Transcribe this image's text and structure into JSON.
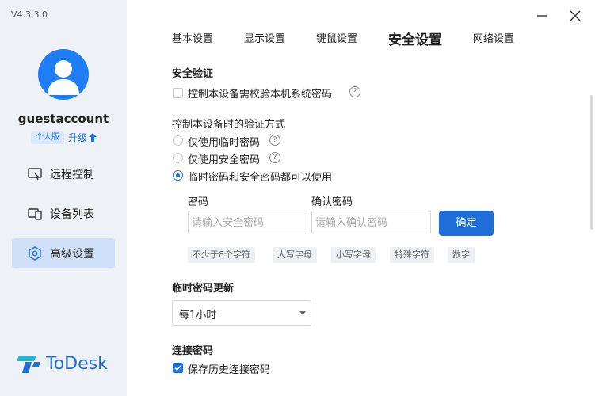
{
  "app": {
    "version": "V4.3.3.0",
    "logo_text": "ToDesk"
  },
  "user": {
    "name": "guestaccount",
    "edition": "个人版",
    "upgrade_label": "升级"
  },
  "sidebar": {
    "items": [
      {
        "label": "远程控制",
        "icon": "remote-control-icon"
      },
      {
        "label": "设备列表",
        "icon": "device-list-icon"
      },
      {
        "label": "高级设置",
        "icon": "hexagon-settings-icon",
        "active": true
      }
    ]
  },
  "tabs": [
    {
      "label": "基本设置"
    },
    {
      "label": "显示设置"
    },
    {
      "label": "键鼠设置"
    },
    {
      "label": "安全设置",
      "active": true
    },
    {
      "label": "网络设置"
    }
  ],
  "security": {
    "verify_title": "安全验证",
    "verify_option": {
      "label": "控制本设备需校验本机系统密码",
      "checked": false
    },
    "method_title": "控制本设备时的验证方式",
    "methods": [
      {
        "label": "仅使用临时密码",
        "selected": false,
        "help": true
      },
      {
        "label": "仅使用安全密码",
        "selected": false,
        "help": true
      },
      {
        "label": "临时密码和安全密码都可以使用",
        "selected": true,
        "help": false
      }
    ],
    "password_label": "密码",
    "password_placeholder": "请输入安全密码",
    "confirm_label": "确认密码",
    "confirm_placeholder": "请输入确认密码",
    "confirm_button": "确定",
    "rules": [
      "不少于8个字符",
      "大写字母",
      "小写字母",
      "特殊字符",
      "数字"
    ]
  },
  "temp_password": {
    "title": "临时密码更新",
    "selected": "每1小时"
  },
  "connect_password": {
    "title": "连接密码",
    "save_history": {
      "label": "保存历史连接密码",
      "checked": true
    }
  },
  "colors": {
    "accent": "#1f6ed8",
    "sidebar_bg": "#eef1f6",
    "active_nav_bg": "#cfe0f8"
  }
}
